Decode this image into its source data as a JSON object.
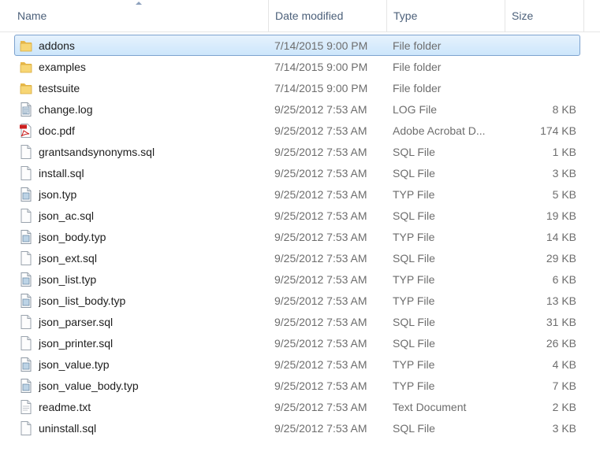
{
  "columns": {
    "name": "Name",
    "date": "Date modified",
    "type": "Type",
    "size": "Size"
  },
  "files": [
    {
      "name": "addons",
      "date": "7/14/2015 9:00 PM",
      "type": "File folder",
      "size": "",
      "icon": "folder-icon",
      "selected": true
    },
    {
      "name": "examples",
      "date": "7/14/2015 9:00 PM",
      "type": "File folder",
      "size": "",
      "icon": "folder-icon"
    },
    {
      "name": "testsuite",
      "date": "7/14/2015 9:00 PM",
      "type": "File folder",
      "size": "",
      "icon": "folder-icon"
    },
    {
      "name": "change.log",
      "date": "9/25/2012 7:53 AM",
      "type": "LOG File",
      "size": "8 KB",
      "icon": "log-file-icon"
    },
    {
      "name": "doc.pdf",
      "date": "9/25/2012 7:53 AM",
      "type": "Adobe Acrobat D...",
      "size": "174 KB",
      "icon": "pdf-file-icon"
    },
    {
      "name": "grantsandsynonyms.sql",
      "date": "9/25/2012 7:53 AM",
      "type": "SQL File",
      "size": "1 KB",
      "icon": "file-icon"
    },
    {
      "name": "install.sql",
      "date": "9/25/2012 7:53 AM",
      "type": "SQL File",
      "size": "3 KB",
      "icon": "file-icon"
    },
    {
      "name": "json.typ",
      "date": "9/25/2012 7:53 AM",
      "type": "TYP File",
      "size": "5 KB",
      "icon": "typ-file-icon"
    },
    {
      "name": "json_ac.sql",
      "date": "9/25/2012 7:53 AM",
      "type": "SQL File",
      "size": "19 KB",
      "icon": "file-icon"
    },
    {
      "name": "json_body.typ",
      "date": "9/25/2012 7:53 AM",
      "type": "TYP File",
      "size": "14 KB",
      "icon": "typ-file-icon"
    },
    {
      "name": "json_ext.sql",
      "date": "9/25/2012 7:53 AM",
      "type": "SQL File",
      "size": "29 KB",
      "icon": "file-icon"
    },
    {
      "name": "json_list.typ",
      "date": "9/25/2012 7:53 AM",
      "type": "TYP File",
      "size": "6 KB",
      "icon": "typ-file-icon"
    },
    {
      "name": "json_list_body.typ",
      "date": "9/25/2012 7:53 AM",
      "type": "TYP File",
      "size": "13 KB",
      "icon": "typ-file-icon"
    },
    {
      "name": "json_parser.sql",
      "date": "9/25/2012 7:53 AM",
      "type": "SQL File",
      "size": "31 KB",
      "icon": "file-icon"
    },
    {
      "name": "json_printer.sql",
      "date": "9/25/2012 7:53 AM",
      "type": "SQL File",
      "size": "26 KB",
      "icon": "file-icon"
    },
    {
      "name": "json_value.typ",
      "date": "9/25/2012 7:53 AM",
      "type": "TYP File",
      "size": "4 KB",
      "icon": "typ-file-icon"
    },
    {
      "name": "json_value_body.typ",
      "date": "9/25/2012 7:53 AM",
      "type": "TYP File",
      "size": "7 KB",
      "icon": "typ-file-icon"
    },
    {
      "name": "readme.txt",
      "date": "9/25/2012 7:53 AM",
      "type": "Text Document",
      "size": "2 KB",
      "icon": "text-file-icon"
    },
    {
      "name": "uninstall.sql",
      "date": "9/25/2012 7:53 AM",
      "type": "SQL File",
      "size": "3 KB",
      "icon": "file-icon"
    }
  ],
  "colors": {
    "selection_border": "#7da2ce",
    "selection_fill": "#cde6fb",
    "header_text": "#4c607a",
    "detail_text": "#6d6d6d"
  }
}
